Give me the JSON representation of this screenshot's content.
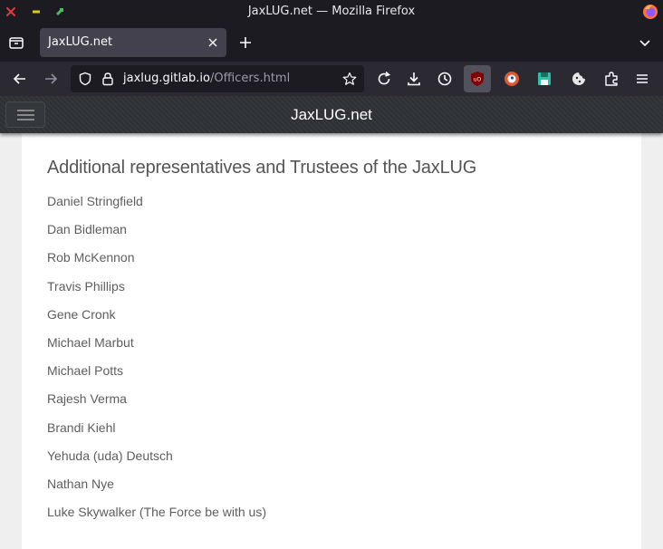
{
  "window": {
    "title": "JaxLUG.net — Mozilla Firefox"
  },
  "browser": {
    "tab": {
      "title": "JaxLUG.net"
    },
    "address": {
      "host": "jaxlug.gitlab.io",
      "path": "/Officers.html"
    }
  },
  "site": {
    "brand": "JaxLUG.net",
    "heading": "Additional representatives and Trustees of the JaxLUG",
    "members": [
      "Daniel Stringfield",
      "Dan Bidleman",
      "Rob McKennon",
      "Travis Phillips",
      "Gene Cronk",
      "Michael Marbut",
      "Michael Potts",
      "Rajesh Verma",
      "Brandi Kiehl",
      "Yehuda (uda) Deutsch",
      "Nathan Nye",
      "Luke Skywalker (The Force be with us)"
    ]
  },
  "colors": {
    "accent_close": "#e5383b",
    "accent_min": "#d8c91b",
    "accent_max": "#3fbf5f"
  },
  "icons": {
    "titlebar": [
      "close-icon",
      "minimize-icon",
      "maximize-icon",
      "firefox-icon"
    ],
    "toolbar": [
      "back-icon",
      "forward-icon",
      "shield-icon",
      "lock-icon",
      "star-icon",
      "reload-icon",
      "download-icon",
      "history-icon",
      "ublock-icon",
      "duckduckgo-icon",
      "save-icon",
      "cookie-icon",
      "extensions-icon",
      "menu-icon"
    ]
  }
}
